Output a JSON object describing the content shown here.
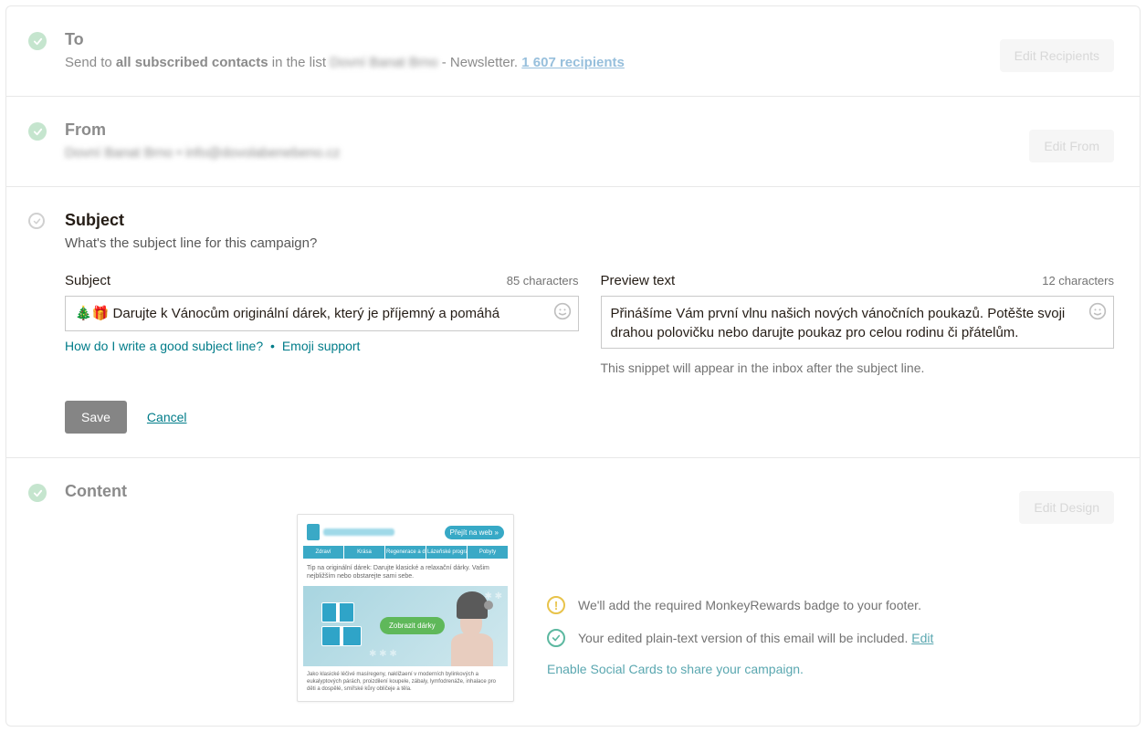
{
  "to": {
    "title": "To",
    "sendToPrefix": "Send to ",
    "sendToBold": "all subscribed contacts",
    "inList": " in the list ",
    "listName": "Dovní Banat Brno",
    "suffix": " - Newsletter. ",
    "recipients": "1 607 recipients",
    "editBtn": "Edit Recipients"
  },
  "from": {
    "title": "From",
    "details": "Dovní Banat Brno • info@dovolabenebeno.cz",
    "editBtn": "Edit From"
  },
  "subject": {
    "title": "Subject",
    "question": "What's the subject line for this campaign?",
    "subjectLabel": "Subject",
    "subjectChars": "85 characters",
    "subjectValue": "🎄🎁 Darujte k Vánocům originální dárek, který je příjemný a pomáhá",
    "previewLabel": "Preview text",
    "previewChars": "12 characters",
    "previewValue": "Přinášíme Vám první vlnu našich nových vánočních poukazů. Potěšte svoji drahou polovičku nebo darujte poukaz pro celou rodinu či přátelům.",
    "helpLink": "How do I write a good subject line?",
    "emojiHelp": "Emoji support",
    "snippetNote": "This snippet will appear in the inbox after the subject line.",
    "saveBtn": "Save",
    "cancelBtn": "Cancel"
  },
  "content": {
    "title": "Content",
    "editBtn": "Edit Design",
    "preview": {
      "pill": "Přejít na web »",
      "nav": [
        "Zdraví",
        "Krása",
        "Regenerace a design těla",
        "Lázeňské programy",
        "Pobyty"
      ],
      "desc": "Tip na originální dárek: Darujte klasické a relaxační dárky. Vašim nejbližším nebo obstarejte sami sebe.",
      "cta": "Zobrazit dárky",
      "body": "Jako klasické léčivé masíregeny, nakližaení v moderních bylinkových a eukalyptových párách, proizdilení koupele, zábaly, lymfodrenáže, inhalace pro děti a dospělé, smířské kůry obličeje a těla."
    },
    "msg1": "We'll add the required MonkeyRewards badge to your footer.",
    "msg2a": "Your edited plain-text version of this email will be included. ",
    "msg2edit": "Edit",
    "socialCards": "Enable Social Cards to share your campaign."
  }
}
